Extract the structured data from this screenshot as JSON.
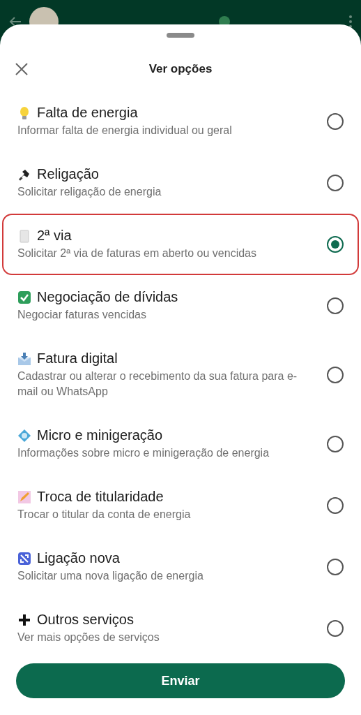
{
  "sheet": {
    "title": "Ver opções"
  },
  "options": [
    {
      "title": "Falta de energia",
      "subtitle": "Informar falta de energia individual ou geral",
      "selected": false
    },
    {
      "title": "Religação",
      "subtitle": "Solicitar religação de energia",
      "selected": false
    },
    {
      "title": "2ª via",
      "subtitle": "Solicitar 2ª via de faturas em aberto ou vencidas",
      "selected": true
    },
    {
      "title": "Negociação de dívidas",
      "subtitle": "Negociar faturas vencidas",
      "selected": false
    },
    {
      "title": "Fatura digital",
      "subtitle": "Cadastrar ou alterar o recebimento da sua fatura para e-mail ou WhatsApp",
      "selected": false
    },
    {
      "title": "Micro e minigeração",
      "subtitle": "Informações sobre micro e minigeração de energia",
      "selected": false
    },
    {
      "title": "Troca de titularidade",
      "subtitle": "Trocar o titular da conta de energia",
      "selected": false
    },
    {
      "title": "Ligação nova",
      "subtitle": "Solicitar uma nova ligação de energia",
      "selected": false
    },
    {
      "title": "Outros serviços",
      "subtitle": "Ver mais opções de serviços",
      "selected": false
    }
  ],
  "button": "Enviar"
}
